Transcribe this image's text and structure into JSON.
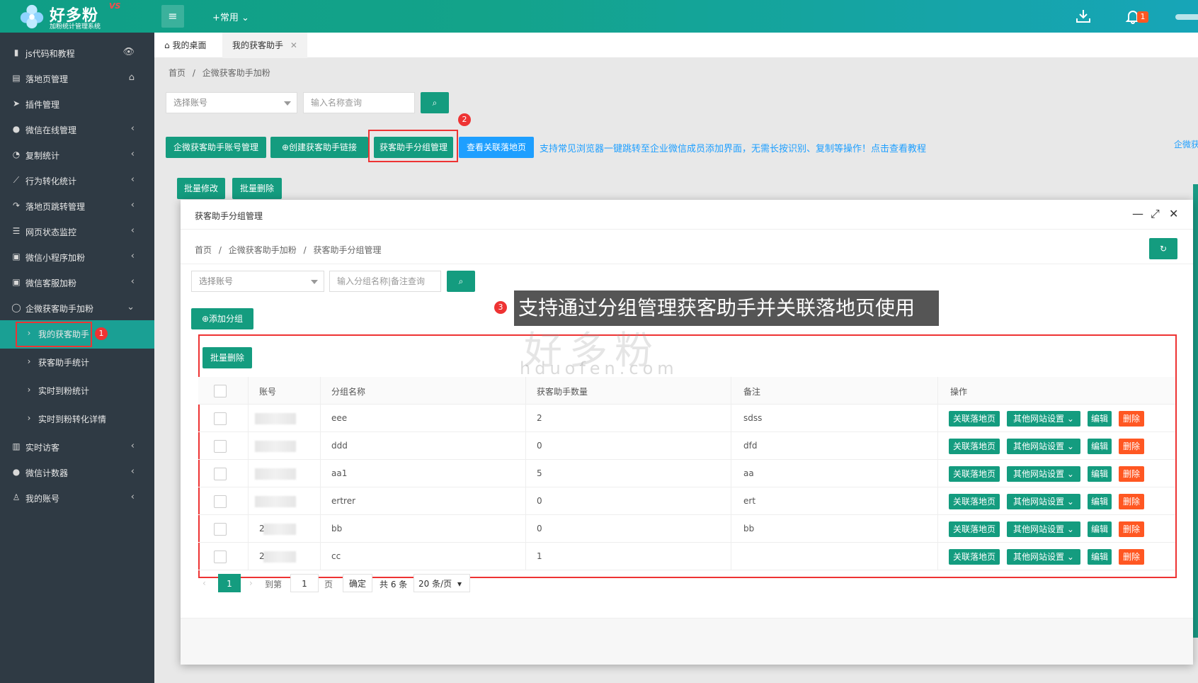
{
  "header": {
    "logo_name": "好多粉",
    "logo_sub": "加粉统计管理系统",
    "logo_version": "VS",
    "common_menu": "+常用",
    "notification_count": "1"
  },
  "sidebar": {
    "items": [
      {
        "label": "js代码和教程",
        "icon": "bookmark-icon"
      },
      {
        "label": "落地页管理",
        "icon": "page-icon"
      },
      {
        "label": "插件管理",
        "icon": "plane-icon"
      },
      {
        "label": "微信在线管理",
        "icon": "wechat-icon"
      },
      {
        "label": "复制统计",
        "icon": "pie-icon"
      },
      {
        "label": "行为转化统计",
        "icon": "line-chart-icon"
      },
      {
        "label": "落地页跳转管理",
        "icon": "share-icon"
      },
      {
        "label": "网页状态监控",
        "icon": "list-icon"
      },
      {
        "label": "微信小程序加粉",
        "icon": "image-icon"
      },
      {
        "label": "微信客服加粉",
        "icon": "image-icon"
      },
      {
        "label": "企微获客助手加粉",
        "icon": "search-icon"
      }
    ],
    "sub_items": [
      {
        "label": "我的获客助手"
      },
      {
        "label": "获客助手统计"
      },
      {
        "label": "实时到粉统计"
      },
      {
        "label": "实时到粉转化详情"
      }
    ],
    "bottom_items": [
      {
        "label": "实时访客",
        "icon": "bar-chart-icon"
      },
      {
        "label": "微信计数器",
        "icon": "wechat-icon"
      },
      {
        "label": "我的账号",
        "icon": "user-icon"
      }
    ]
  },
  "tabs": [
    {
      "label": "我的桌面"
    },
    {
      "label": "我的获客助手"
    }
  ],
  "page": {
    "crumb_home": "首页",
    "crumb_sep": "/",
    "crumb_current": "企微获客助手加粉",
    "account_select": "选择账号",
    "name_search_placeholder": "输入名称查询",
    "btn_account_manage": "企微获客助手账号管理",
    "btn_create_link": "创建获客助手链接",
    "btn_group_manage": "获客助手分组管理",
    "btn_view_landing": "查看关联落地页",
    "tip_text": "支持常见浏览器一键跳转至企业微信成员添加界面，无需长按识别、复制等操作！点击查看教程",
    "right_edge_text": "企微获",
    "btn_batch_edit": "批量修改",
    "btn_batch_delete": "批量删除"
  },
  "modal": {
    "title": "获客助手分组管理",
    "crumb_home": "首页",
    "crumb_sep": "/",
    "crumb_mid": "企微获客助手加粉",
    "crumb_current": "获客助手分组管理",
    "account_select": "选择账号",
    "search_placeholder": "输入分组名称|备注查询",
    "btn_add_group": "添加分组",
    "btn_batch_delete": "批量删除",
    "columns": [
      "账号",
      "分组名称",
      "获客助手数量",
      "备注",
      "操作"
    ],
    "rows": [
      {
        "account": "",
        "group": "eee",
        "count": "2",
        "remark": "sdss"
      },
      {
        "account": "",
        "group": "ddd",
        "count": "0",
        "remark": "dfd"
      },
      {
        "account": "",
        "group": "aa1",
        "count": "5",
        "remark": "aa"
      },
      {
        "account": "",
        "group": "ertrer",
        "count": "0",
        "remark": "ert"
      },
      {
        "account": "2",
        "group": "bb",
        "count": "0",
        "remark": "bb"
      },
      {
        "account": "2",
        "group": "cc",
        "count": "1",
        "remark": ""
      }
    ],
    "action_link": "关联落地页",
    "action_other": "其他网站设置",
    "action_edit": "编辑",
    "action_delete": "删除",
    "pager": {
      "current": "1",
      "goto": "到第",
      "page_input": "1",
      "page_unit": "页",
      "confirm": "确定",
      "total": "共 6 条",
      "page_size": "20 条/页"
    }
  },
  "annotation": {
    "num1": "1",
    "num2": "2",
    "num3": "3",
    "text": "支持通过分组管理获客助手并关联落地页使用",
    "watermark_cn": "好多粉",
    "watermark_en": "hduofen.com"
  }
}
